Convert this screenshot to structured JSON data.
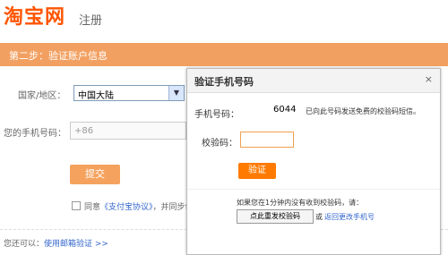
{
  "brand": {
    "logo": "淘宝网",
    "subtitle": "注册"
  },
  "step": {
    "title": "第二步：验证账户信息"
  },
  "form": {
    "region_label": "国家/地区：",
    "region_value": "中国大陆",
    "phone_label": "您的手机号码：",
    "phone_prefix": "+86",
    "submit_label": "提交",
    "agree_prefix": "同意",
    "agree_link": "《支付宝协议》",
    "agree_suffix": "，并同步创",
    "alt_prefix": "您还可以：",
    "alt_link": "使用邮箱验证 >>"
  },
  "modal": {
    "title": "验证手机号码",
    "close": "×",
    "phone_label": "手机号码：",
    "phone_value": "6044",
    "phone_note": "已向此号码发送免费的校验码短信。",
    "code_label": "校验码：",
    "code_placeholder": "",
    "verify_label": "验证",
    "resend_note": "如果您在1分钟内没有收到校验码，请：",
    "resend_label": "点此重发校验码",
    "or_text": "或",
    "change_phone": "返回更改手机号"
  }
}
